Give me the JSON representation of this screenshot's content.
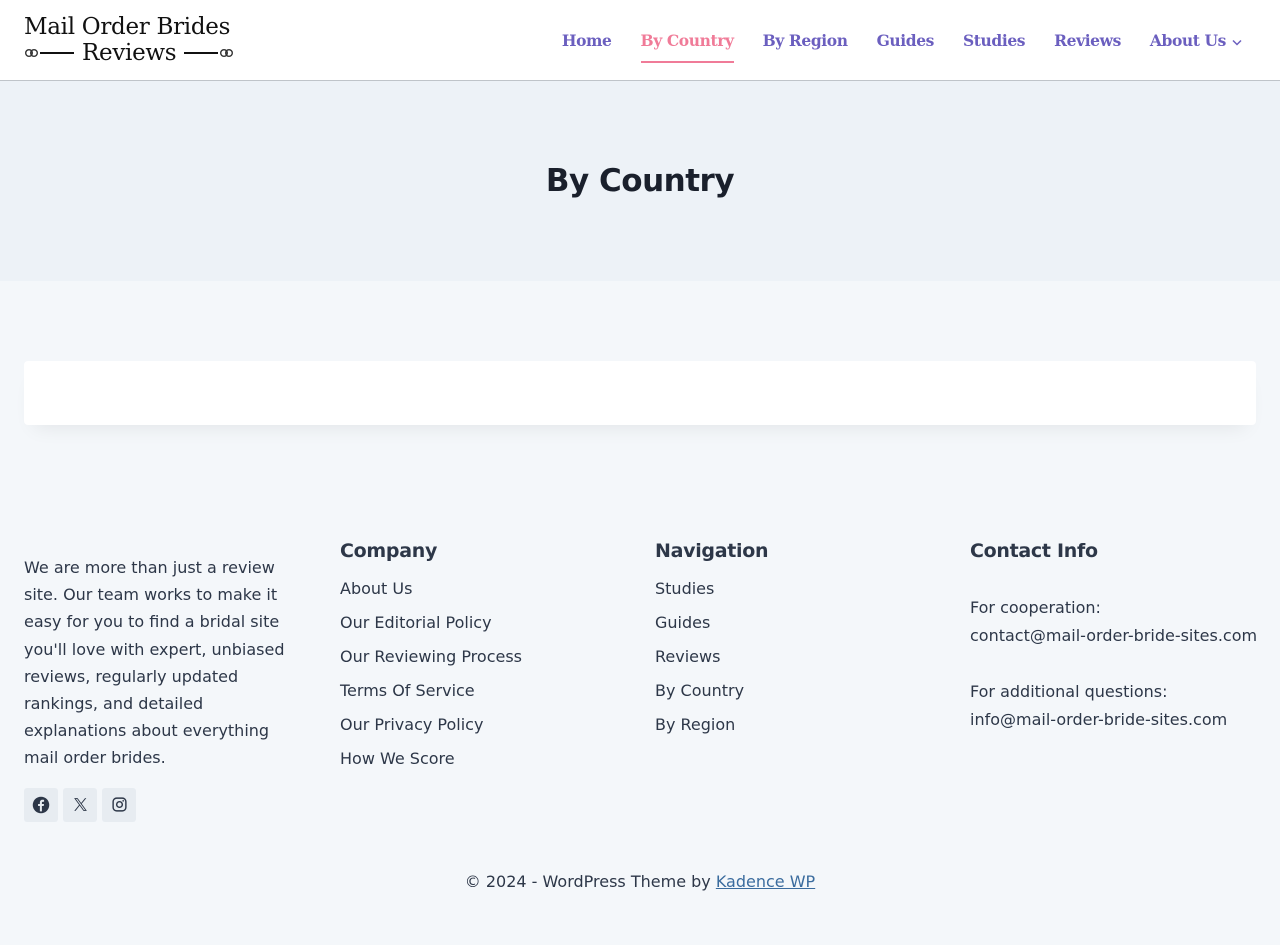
{
  "header": {
    "logo_line1": "Mail Order Brides",
    "logo_line2": "Reviews",
    "nav": [
      {
        "label": "Home"
      },
      {
        "label": "By Country"
      },
      {
        "label": "By Region"
      },
      {
        "label": "Guides"
      },
      {
        "label": "Studies"
      },
      {
        "label": "Reviews"
      },
      {
        "label": "About Us"
      }
    ]
  },
  "hero": {
    "title": "By Country"
  },
  "footer": {
    "about_text": "We are more than just a review site. Our team works to make it easy for you to find a bridal site you'll love with expert, unbiased reviews, regularly updated rankings, and detailed explanations about everything mail order brides.",
    "socials": [
      {
        "icon": "facebook-icon"
      },
      {
        "icon": "x-icon"
      },
      {
        "icon": "instagram-icon"
      }
    ],
    "company": {
      "heading": "Company",
      "links": [
        "About Us",
        "Our Editorial Policy",
        "Our Reviewing Process",
        "Terms Of Service",
        "Our Privacy Policy",
        "How We Score"
      ]
    },
    "navigation": {
      "heading": "Navigation",
      "links": [
        "Studies",
        "Guides",
        "Reviews",
        "By Country",
        "By Region"
      ]
    },
    "contact": {
      "heading": "Contact Info",
      "coop_label": "For cooperation:",
      "coop_email": "contact@mail-order-bride-sites.com",
      "questions_label": "For additional questions:",
      "questions_email": "info@mail-order-bride-sites.com"
    },
    "copyright_prefix": "© 2024 - WordPress Theme by ",
    "copyright_link": "Kadence WP"
  },
  "colors": {
    "nav": "#6b5fbf",
    "nav_active": "#f07b98",
    "hero_bg": "#edf2f7",
    "page_bg": "#f4f7fa",
    "link": "#3b6c9e"
  }
}
